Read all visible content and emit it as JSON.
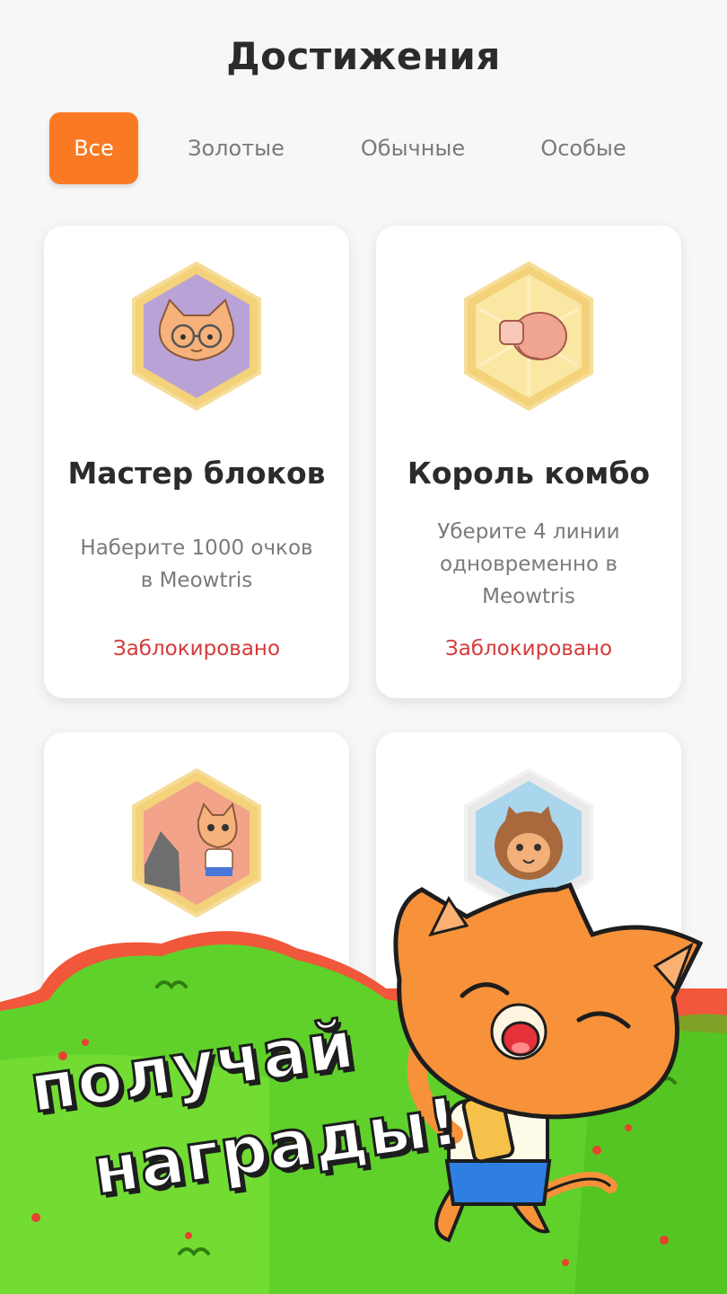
{
  "header": {
    "title": "Достижения"
  },
  "tabs": [
    {
      "label": "Все",
      "active": true
    },
    {
      "label": "Золотые",
      "active": false
    },
    {
      "label": "Обычные",
      "active": false
    },
    {
      "label": "Особые",
      "active": false
    }
  ],
  "achievements": [
    {
      "title": "Мастер блоков",
      "description": "Наберите 1000 очков в Meowtris",
      "status": "Заблокировано",
      "badge": "cat-with-glasses-icon"
    },
    {
      "title": "Король комбо",
      "description": "Уберите 4 линии одновременно в Meowtris",
      "status": "Заблокировано",
      "badge": "boxing-glove-icon"
    },
    {
      "title": "",
      "description": "",
      "status": "",
      "badge": "cat-high-five-icon"
    },
    {
      "title": "",
      "description": "",
      "status": "",
      "badge": "brown-cat-face-icon"
    }
  ],
  "promo": {
    "line1": "получай",
    "line2": "награды!"
  },
  "colors": {
    "accent": "#f97a23",
    "locked": "#d63a3a",
    "grass": "#5fd12a",
    "gold_badge": "#f3d27a",
    "purple_badge": "#b9a2d6",
    "coral_badge": "#f2a38a",
    "blue_badge": "#a9d6ec"
  }
}
